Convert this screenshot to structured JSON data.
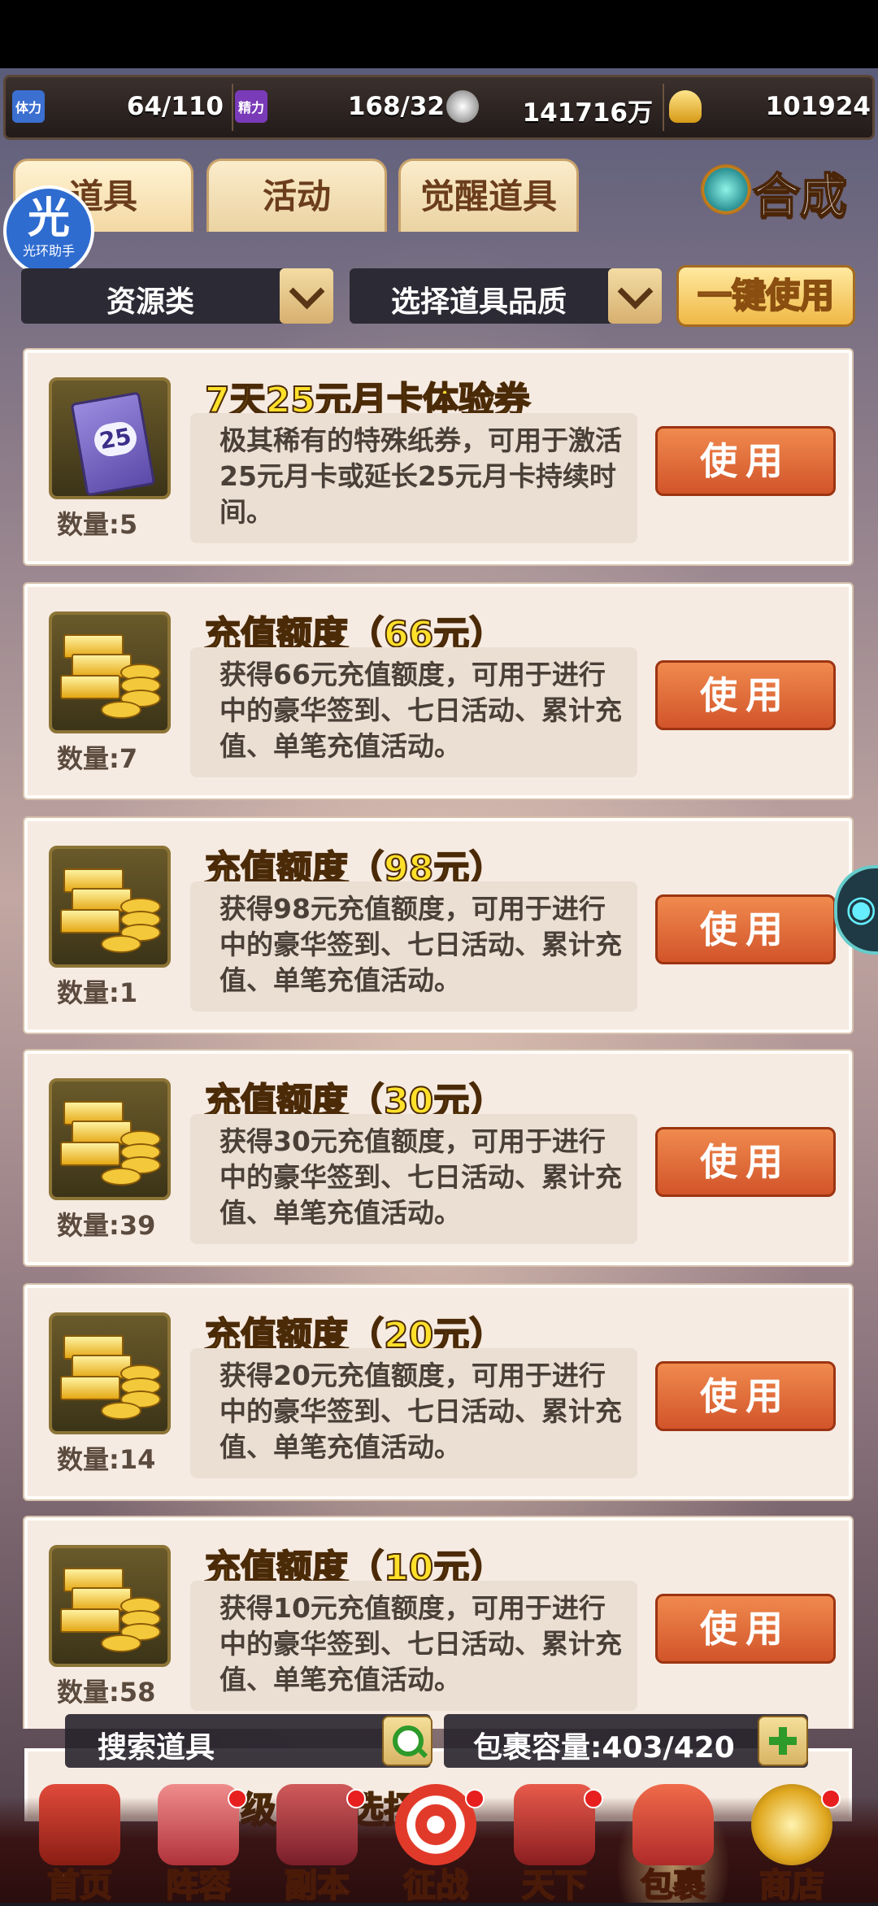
{
  "resources": {
    "stamina": {
      "label": "体力",
      "value": "64/110"
    },
    "energy": {
      "label": "精力",
      "value": "168/32"
    },
    "silver": {
      "value": "141716万"
    },
    "gold": {
      "value": "101924"
    }
  },
  "tabs": [
    {
      "label": "道具"
    },
    {
      "label": "活动"
    },
    {
      "label": "觉醒道具"
    }
  ],
  "helper": {
    "char": "光",
    "label": "光环助手"
  },
  "compose": {
    "label": "合成"
  },
  "filters": {
    "category": "资源类",
    "quality": "选择道具品质",
    "use_all": "一键使用"
  },
  "items": [
    {
      "title": "7天25元月卡体验券",
      "qty_prefix": "数量:",
      "qty": "5",
      "icon": "25",
      "desc": "极其稀有的特殊纸券，可用于激活25元月卡或延长25元月卡持续时间。",
      "button": "使用"
    },
    {
      "title": "充值额度（66元）",
      "qty_prefix": "数量:",
      "qty": "7",
      "desc": "获得66元充值额度，可用于进行中的豪华签到、七日活动、累计充值、单笔充值活动。",
      "button": "使用"
    },
    {
      "title": "充值额度（98元）",
      "qty_prefix": "数量:",
      "qty": "1",
      "desc": "获得98元充值额度，可用于进行中的豪华签到、七日活动、累计充值、单笔充值活动。",
      "button": "使用"
    },
    {
      "title": "充值额度（30元）",
      "qty_prefix": "数量:",
      "qty": "39",
      "desc": "获得30元充值额度，可用于进行中的豪华签到、七日活动、累计充值、单笔充值活动。",
      "button": "使用"
    },
    {
      "title": "充值额度（20元）",
      "qty_prefix": "数量:",
      "qty": "14",
      "desc": "获得20元充值额度，可用于进行中的豪华签到、七日活动、累计充值、单笔充值活动。",
      "button": "使用"
    },
    {
      "title": "充值额度（10元）",
      "qty_prefix": "数量:",
      "qty": "58",
      "desc": "获得10元充值额度，可用于进行中的豪华签到、七日活动、累计充值、单笔充值活动。",
      "button": "使用"
    }
  ],
  "peek_item": {
    "title": "初级异族选择箱"
  },
  "search": {
    "placeholder": "搜索道具"
  },
  "capacity": {
    "text": "包裹容量:403/420"
  },
  "nav": [
    {
      "label": "首页",
      "dot": false
    },
    {
      "label": "阵容",
      "dot": true
    },
    {
      "label": "副本",
      "dot": true
    },
    {
      "label": "征战",
      "dot": true
    },
    {
      "label": "天下",
      "dot": true
    },
    {
      "label": "包裹",
      "dot": false
    },
    {
      "label": "商店",
      "dot": true
    }
  ],
  "colors": {
    "title_yellow": "#ffe02a",
    "use_button": "#d2542a",
    "card_bg": "#f6ebe2"
  }
}
